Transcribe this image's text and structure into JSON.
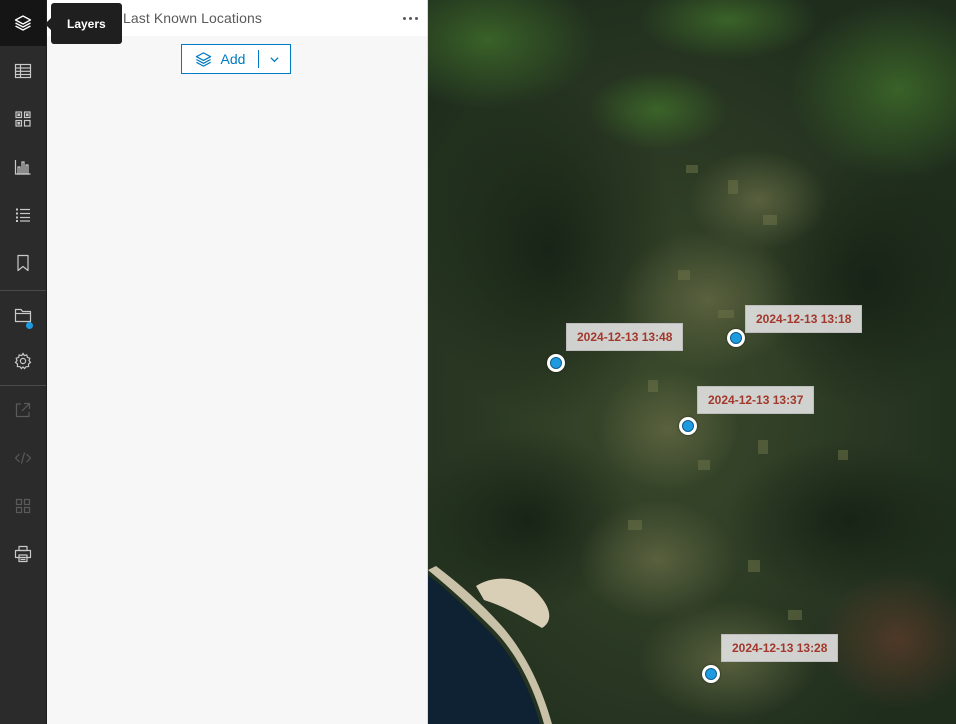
{
  "toolbar": {
    "items": [
      {
        "name": "layers",
        "icon": "layers-icon",
        "active": true
      },
      {
        "name": "table",
        "icon": "table-icon"
      },
      {
        "name": "widgets",
        "icon": "grid-icon"
      },
      {
        "name": "charts",
        "icon": "bar-chart-icon"
      },
      {
        "name": "legend",
        "icon": "list-icon"
      },
      {
        "name": "bookmarks",
        "icon": "bookmark-icon"
      },
      {
        "name": "map-properties",
        "icon": "folder-icon",
        "badge": true
      },
      {
        "name": "settings",
        "icon": "gear-icon"
      },
      {
        "name": "share",
        "icon": "share-icon",
        "disabled": true
      },
      {
        "name": "embed",
        "icon": "code-icon",
        "disabled": true
      },
      {
        "name": "apps",
        "icon": "apps-icon",
        "disabled": true
      },
      {
        "name": "print",
        "icon": "print-icon"
      }
    ],
    "badge_color": "#1e9be0"
  },
  "tooltip": {
    "text": "Layers"
  },
  "panel": {
    "title": "Last Known Locations",
    "add_label": "Add"
  },
  "map": {
    "labels": [
      {
        "text": "2024-12-13 13:48"
      },
      {
        "text": "2024-12-13 13:18"
      },
      {
        "text": "2024-12-13 13:37"
      },
      {
        "text": "2024-12-13 13:28"
      }
    ],
    "label_color": "#a2372b",
    "marker_color": "#1e9be0"
  }
}
